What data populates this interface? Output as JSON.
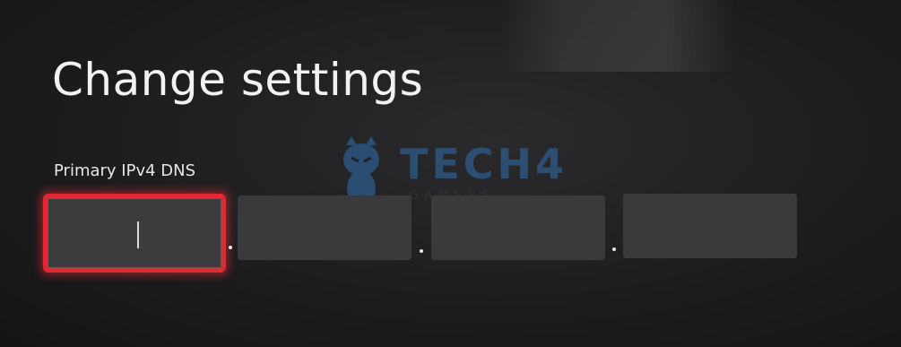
{
  "header": {
    "title": "Change settings"
  },
  "dns_form": {
    "label": "Primary IPv4 DNS",
    "octets": [
      "",
      "",
      "",
      ""
    ],
    "focused_index": 0,
    "separator": ".",
    "focus_color": "#e02834"
  },
  "watermark": {
    "brand": "TECH4",
    "sub": "GAMERS",
    "color": "#2f6fae"
  }
}
